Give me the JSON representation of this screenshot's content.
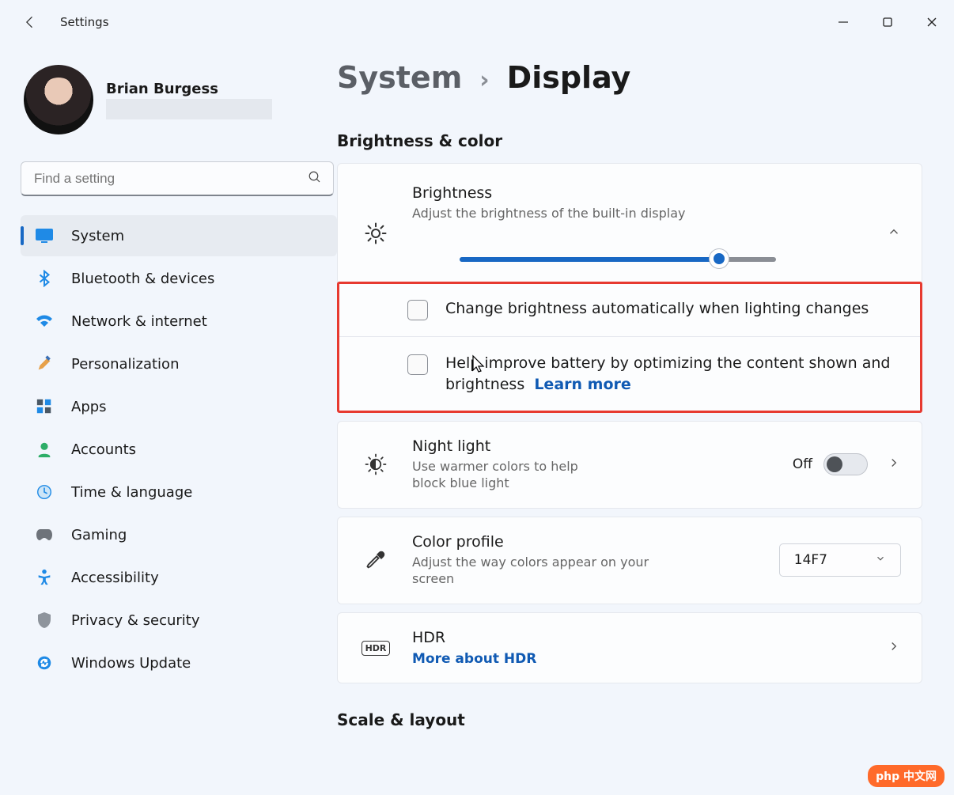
{
  "window": {
    "title": "Settings"
  },
  "profile": {
    "name": "Brian Burgess"
  },
  "search": {
    "placeholder": "Find a setting"
  },
  "nav": {
    "items": [
      {
        "label": "System"
      },
      {
        "label": "Bluetooth & devices"
      },
      {
        "label": "Network & internet"
      },
      {
        "label": "Personalization"
      },
      {
        "label": "Apps"
      },
      {
        "label": "Accounts"
      },
      {
        "label": "Time & language"
      },
      {
        "label": "Gaming"
      },
      {
        "label": "Accessibility"
      },
      {
        "label": "Privacy & security"
      },
      {
        "label": "Windows Update"
      }
    ]
  },
  "breadcrumb": {
    "parent": "System",
    "current": "Display",
    "sep": "›"
  },
  "section1": {
    "heading": "Brightness & color"
  },
  "brightness": {
    "title": "Brightness",
    "subtitle": "Adjust the brightness of the built-in display",
    "value_percent": 82,
    "check1": "Change brightness automatically when lighting changes",
    "check2_a": "Help improve battery by optimizing the content shown and brightness",
    "check2_link": "Learn more"
  },
  "nightlight": {
    "title": "Night light",
    "subtitle": "Use warmer colors to help block blue light",
    "state": "Off"
  },
  "colorprofile": {
    "title": "Color profile",
    "subtitle": "Adjust the way colors appear on your screen",
    "value": "14F7"
  },
  "hdr": {
    "title": "HDR",
    "link": "More about HDR"
  },
  "section2": {
    "heading": "Scale & layout"
  },
  "watermark": "php 中文网"
}
